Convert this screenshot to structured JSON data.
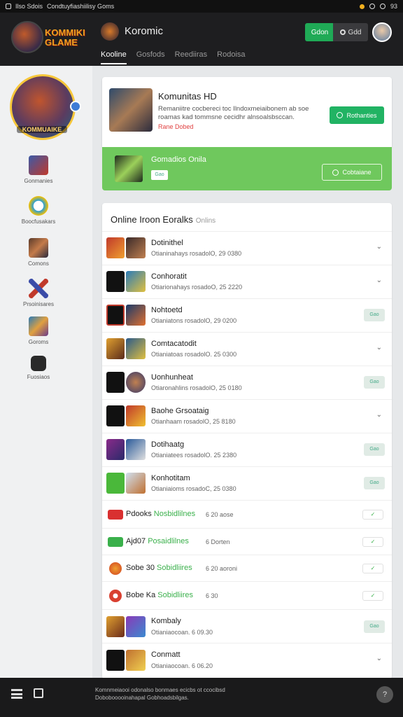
{
  "status_bar": {
    "left_text": "Ilso Sdois",
    "app_text": "Condtuyfiashiilisy Goms",
    "battery": "93"
  },
  "header": {
    "logo_text_1": "KOMMIKI",
    "logo_text_2": "GLAME",
    "app_title": "Koromic",
    "tabs": [
      {
        "label": "Kooline",
        "active": true
      },
      {
        "label": "Gosfods",
        "active": false
      },
      {
        "label": "Reediiras",
        "active": false
      },
      {
        "label": "Rodoisa",
        "active": false
      }
    ],
    "green_button": "Gdon",
    "dark_button": "Gdd"
  },
  "sidebar": {
    "profile_label": "KOMMUAIKE",
    "items": [
      {
        "label": "Gonmanies",
        "icon": "sword-icon"
      },
      {
        "label": "Boocfusakars",
        "icon": "avatar-icon"
      },
      {
        "label": "Comons",
        "icon": "game-icon"
      },
      {
        "label": "Prsoinisares",
        "icon": "crossed-swords-icon"
      },
      {
        "label": "Goroms",
        "icon": "hero-icon"
      },
      {
        "label": "Fuosiaos",
        "icon": "puzzle-icon"
      }
    ]
  },
  "featured": {
    "title": "Komunitas HD",
    "description": "Remaniitre cocbereci toc Ilndoxmeiaibonem ab soe roamas kad tommsne cecidhr alnsoalsbsccan.",
    "tag": "Rane Dobed",
    "button": "Rothanties"
  },
  "banner": {
    "title": "Gomadios Onila",
    "small_label": "Gao",
    "button": "Cobtaiane"
  },
  "online": {
    "title": "Online Iroon Eoralks",
    "subtitle": "Onlins",
    "rows": [
      {
        "name": "Dotinithel",
        "meta": "Otianinahays rosadolO, 29 0380",
        "action": "chevron"
      },
      {
        "name": "Conhoratit",
        "meta": "Otiarionahays rosadoO, 25 2220",
        "action": "chevron"
      },
      {
        "name": "Nohtoetd",
        "meta": "Otianiatons rosadolO, 29 0200",
        "action": "pill",
        "pill": "Gao"
      },
      {
        "name": "Comtacatodit",
        "meta": "Otianiatoas rosadolO. 25 0300",
        "action": "chevron"
      },
      {
        "name": "Uonhunheat",
        "meta": "Otiaronahlins rosadolO, 25 0180",
        "action": "pill",
        "pill": "Gao"
      },
      {
        "name": "Baohe Grsoataig",
        "meta": "Otianhaam rosadolO, 25 8180",
        "action": "chevron"
      },
      {
        "name": "Dotihaatg",
        "meta": "Otianiatees rosadolO. 25 2380",
        "action": "pill",
        "pill": "Gao"
      },
      {
        "name": "Konhotitam",
        "meta": "Otianiaioms rosadoC, 25 0380",
        "action": "pill",
        "pill": "Gao"
      }
    ],
    "tournaments": [
      {
        "name": "Pdooks",
        "highlight": "Nosbidlilnes",
        "meta": "6 20 aose",
        "action": "✓"
      },
      {
        "name": "Ajd07",
        "highlight": "Posaidlilnes",
        "meta": "6 Dorten",
        "action": "✓"
      },
      {
        "name": "Sobe 30",
        "highlight": "Sobidliires",
        "meta": "6 20 aoroni",
        "action": "✓"
      },
      {
        "name": "Bobe Ka",
        "highlight": "Sobidliires",
        "meta": "6 30",
        "action": "✓"
      }
    ],
    "bottom_rows": [
      {
        "name": "Kombaly",
        "meta": "Otianiaocoan. 6 09.30",
        "action": "pill",
        "pill": "Gao"
      },
      {
        "name": "Conmatt",
        "meta": "Otianiaocoan. 6 06.20",
        "action": "chevron"
      }
    ]
  },
  "bottom_bar": {
    "text": "Komnmeiaooi odonalso bonmaes ecicbs ot ccocibsd Dobobooooinahapal Gobhoadsbilgas.",
    "help": "?"
  },
  "colors": {
    "accent_green": "#21b363",
    "banner_green": "#6fc85d",
    "header_bg": "#1e1e20"
  }
}
